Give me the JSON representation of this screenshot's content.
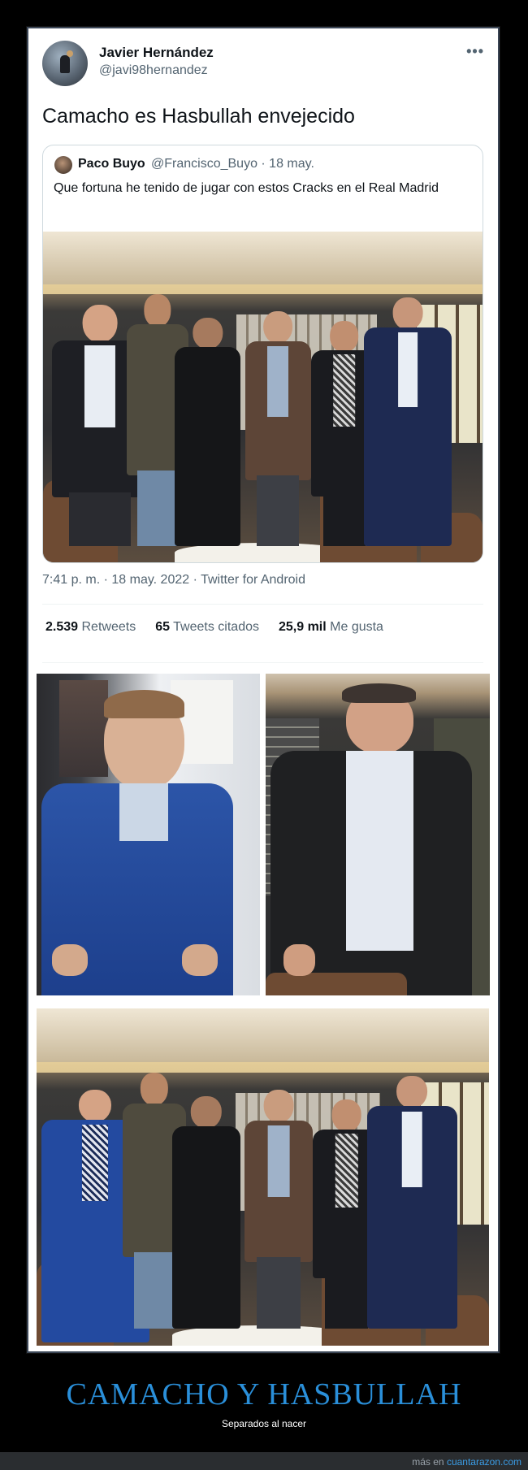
{
  "tweet": {
    "author_name": "Javier Hernández",
    "author_handle": "@javi98hernandez",
    "more_icon": "more-horizontal-icon",
    "text": "Camacho es Hasbullah envejecido",
    "timestamp": "7:41 p. m. · 18 may. 2022 · Twitter for Android",
    "stats": {
      "retweets_value": "2.539",
      "retweets_label": "Retweets",
      "quotes_value": "65",
      "quotes_label": "Tweets citados",
      "likes_value": "25,9 mil",
      "likes_label": "Me gusta"
    }
  },
  "quoted_tweet": {
    "author_name": "Paco Buyo",
    "meta": "@Francisco_Buyo · 18 may.",
    "text": "Que fortuna he tenido de jugar con estos Cracks en el Real Madrid"
  },
  "caption": {
    "title": "CAMACHO Y HASBULLAH",
    "subtitle": "Separados al nacer"
  },
  "footer": {
    "prefix": "más en ",
    "site": "cuantarazon.com"
  },
  "colors": {
    "background": "#000000",
    "title_blue": "#2a8fd9",
    "link_blue": "#3b9de6",
    "card_white": "#ffffff"
  }
}
